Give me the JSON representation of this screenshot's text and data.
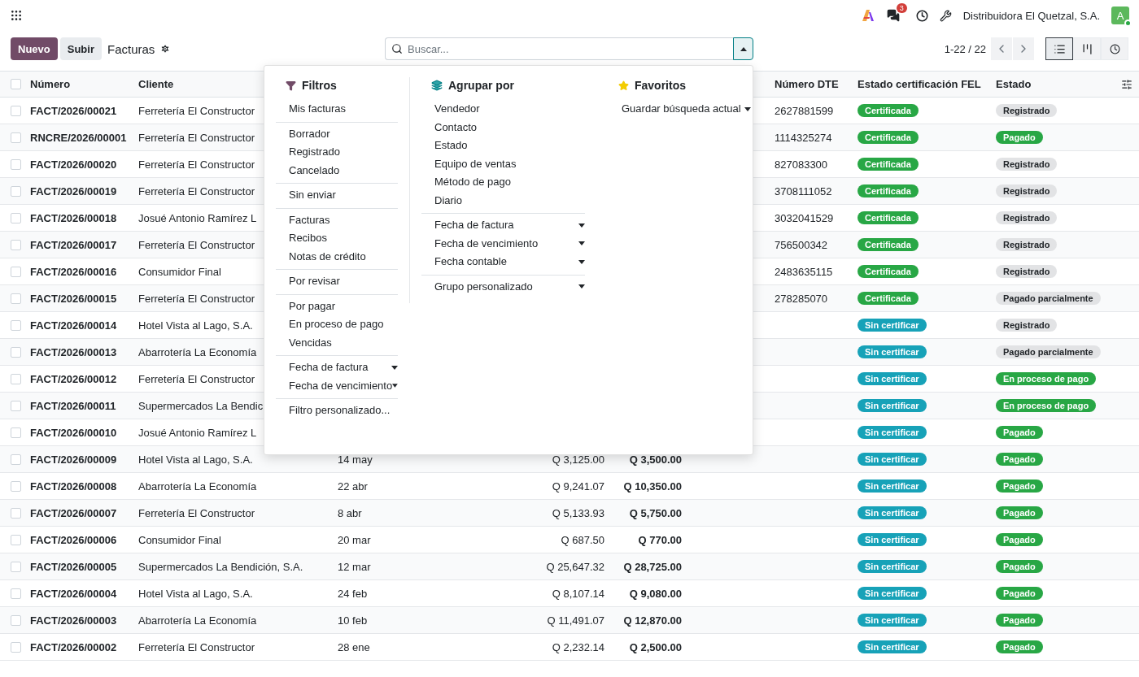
{
  "navbar": {
    "company": "Distribuidora El Quetzal, S.A.",
    "message_count": "3",
    "avatar": "A"
  },
  "control_panel": {
    "new_button": "Nuevo",
    "upload_button": "Subir",
    "title": "Facturas",
    "search": {
      "placeholder": "Buscar..."
    },
    "filter_toggle": {
      "expanded": true
    },
    "pager": "1-22 / 22",
    "views": [
      {
        "kind": "list",
        "selected": true
      },
      {
        "kind": "kanban",
        "selected": false
      },
      {
        "kind": "activity",
        "selected": false
      }
    ]
  },
  "table": {
    "select_all": false,
    "columns": [
      "Número",
      "Cliente",
      "Número DTE",
      "Estado certificación FEL",
      "Estado"
    ],
    "rows": [
      {
        "checked": false,
        "number": "FACT/2026/00021",
        "client": "Ferretería El Constructor",
        "dte": "2627881599",
        "fel": {
          "text": "Certificada",
          "color": "#28a745"
        },
        "status": {
          "text": "Registrado",
          "color": "#e2e3e5"
        }
      },
      {
        "checked": false,
        "number": "RNCRE/2026/00001",
        "client": "Ferretería El Constructor",
        "dte": "1114325274",
        "fel": {
          "text": "Certificada",
          "color": "#28a745"
        },
        "status": {
          "text": "Pagado",
          "color": "#28a745"
        }
      },
      {
        "checked": false,
        "number": "FACT/2026/00020",
        "client": "Ferretería El Constructor",
        "dte": "827083300",
        "fel": {
          "text": "Certificada",
          "color": "#28a745"
        },
        "status": {
          "text": "Registrado",
          "color": "#e2e3e5"
        }
      },
      {
        "checked": false,
        "number": "FACT/2026/00019",
        "client": "Ferretería El Constructor",
        "dte": "3708111052",
        "fel": {
          "text": "Certificada",
          "color": "#28a745"
        },
        "status": {
          "text": "Registrado",
          "color": "#e2e3e5"
        }
      },
      {
        "checked": false,
        "number": "FACT/2026/00018",
        "client": "Josué Antonio Ramírez L",
        "dte": "3032041529",
        "fel": {
          "text": "Certificada",
          "color": "#28a745"
        },
        "status": {
          "text": "Registrado",
          "color": "#e2e3e5"
        }
      },
      {
        "checked": false,
        "number": "FACT/2026/00017",
        "client": "Ferretería El Constructor",
        "dte": "756500342",
        "fel": {
          "text": "Certificada",
          "color": "#28a745"
        },
        "status": {
          "text": "Registrado",
          "color": "#e2e3e5"
        }
      },
      {
        "checked": false,
        "number": "FACT/2026/00016",
        "client": "Consumidor Final",
        "dte": "2483635115",
        "fel": {
          "text": "Certificada",
          "color": "#28a745"
        },
        "status": {
          "text": "Registrado",
          "color": "#e2e3e5"
        }
      },
      {
        "checked": false,
        "number": "FACT/2026/00015",
        "client": "Ferretería El Constructor",
        "dte": "278285070",
        "fel": {
          "text": "Certificada",
          "color": "#28a745"
        },
        "status": {
          "text": "Pagado parcialmente",
          "color": "#e2e3e5"
        }
      },
      {
        "checked": false,
        "number": "FACT/2026/00014",
        "client": "Hotel Vista al Lago, S.A.",
        "fel": {
          "text": "Sin certificar",
          "color": "#17a2b8"
        },
        "status": {
          "text": "Registrado",
          "color": "#e2e3e5"
        }
      },
      {
        "checked": false,
        "number": "FACT/2026/00013",
        "client": "Abarrotería La Economía",
        "fel": {
          "text": "Sin certificar",
          "color": "#17a2b8"
        },
        "status": {
          "text": "Pagado parcialmente",
          "color": "#e2e3e5"
        }
      },
      {
        "checked": false,
        "number": "FACT/2026/00012",
        "client": "Ferretería El Constructor",
        "fel": {
          "text": "Sin certificar",
          "color": "#17a2b8"
        },
        "status": {
          "text": "En proceso de pago",
          "color": "#28a745"
        }
      },
      {
        "checked": false,
        "number": "FACT/2026/00011",
        "client": "Supermercados La Bendic",
        "fel": {
          "text": "Sin certificar",
          "color": "#17a2b8"
        },
        "status": {
          "text": "En proceso de pago",
          "color": "#28a745"
        }
      },
      {
        "checked": false,
        "number": "FACT/2026/00010",
        "client": "Josué Antonio Ramírez L",
        "fel": {
          "text": "Sin certificar",
          "color": "#17a2b8"
        },
        "status": {
          "text": "Pagado",
          "color": "#28a745"
        }
      },
      {
        "checked": false,
        "number": "FACT/2026/00009",
        "client": "Hotel Vista al Lago, S.A.",
        "column_3": "14 may",
        "column_4": "Q 3,125.00",
        "column_5": "Q 3,500.00",
        "fel": {
          "text": "Sin certificar",
          "color": "#17a2b8"
        },
        "status": {
          "text": "Pagado",
          "color": "#28a745"
        }
      },
      {
        "checked": false,
        "number": "FACT/2026/00008",
        "client": "Abarrotería La Economía",
        "column_3": "22 abr",
        "column_4": "Q 9,241.07",
        "column_5": "Q 10,350.00",
        "fel": {
          "text": "Sin certificar",
          "color": "#17a2b8"
        },
        "status": {
          "text": "Pagado",
          "color": "#28a745"
        }
      },
      {
        "checked": false,
        "number": "FACT/2026/00007",
        "client": "Ferretería El Constructor",
        "column_3": "8 abr",
        "column_4": "Q 5,133.93",
        "column_5": "Q 5,750.00",
        "fel": {
          "text": "Sin certificar",
          "color": "#17a2b8"
        },
        "status": {
          "text": "Pagado",
          "color": "#28a745"
        }
      },
      {
        "checked": false,
        "number": "FACT/2026/00006",
        "client": "Consumidor Final",
        "column_3": "20 mar",
        "column_4": "Q 687.50",
        "column_5": "Q 770.00",
        "fel": {
          "text": "Sin certificar",
          "color": "#17a2b8"
        },
        "status": {
          "text": "Pagado",
          "color": "#28a745"
        }
      },
      {
        "checked": false,
        "number": "FACT/2026/00005",
        "client": "Supermercados La Bendición, S.A.",
        "column_3": "12 mar",
        "column_4": "Q 25,647.32",
        "column_5": "Q 28,725.00",
        "fel": {
          "text": "Sin certificar",
          "color": "#17a2b8"
        },
        "status": {
          "text": "Pagado",
          "color": "#28a745"
        }
      },
      {
        "checked": false,
        "number": "FACT/2026/00004",
        "client": "Hotel Vista al Lago, S.A.",
        "column_3": "24 feb",
        "column_4": "Q 8,107.14",
        "column_5": "Q 9,080.00",
        "fel": {
          "text": "Sin certificar",
          "color": "#17a2b8"
        },
        "status": {
          "text": "Pagado",
          "color": "#28a745"
        }
      },
      {
        "checked": false,
        "number": "FACT/2026/00003",
        "client": "Abarrotería La Economía",
        "column_3": "10 feb",
        "column_4": "Q 11,491.07",
        "column_5": "Q 12,870.00",
        "fel": {
          "text": "Sin certificar",
          "color": "#17a2b8"
        },
        "status": {
          "text": "Pagado",
          "color": "#28a745"
        }
      },
      {
        "checked": false,
        "number": "FACT/2026/00002",
        "client": "Ferretería El Constructor",
        "column_3": "28 ene",
        "column_4": "Q 2,232.14",
        "column_5": "Q 2,500.00",
        "fel": {
          "text": "Sin certificar",
          "color": "#17a2b8"
        },
        "status": {
          "text": "Pagado",
          "color": "#28a745"
        }
      }
    ]
  },
  "search_panel": [
    {
      "kind": "filters",
      "title": "Filtros",
      "groups": [
        [
          {
            "label": "Mis facturas",
            "caret": false
          }
        ],
        [
          {
            "label": "Borrador",
            "caret": false
          },
          {
            "label": "Registrado",
            "caret": false
          },
          {
            "label": "Cancelado",
            "caret": false
          }
        ],
        [
          {
            "label": "Sin enviar",
            "caret": false
          }
        ],
        [
          {
            "label": "Facturas",
            "caret": false
          },
          {
            "label": "Recibos",
            "caret": false
          },
          {
            "label": "Notas de crédito",
            "caret": false
          }
        ],
        [
          {
            "label": "Por revisar",
            "caret": false
          }
        ],
        [
          {
            "label": "Por pagar",
            "caret": false
          },
          {
            "label": "En proceso de pago",
            "caret": false
          },
          {
            "label": "Vencidas",
            "caret": false
          }
        ],
        [
          {
            "label": "Fecha de factura",
            "caret": true
          },
          {
            "label": "Fecha de vencimiento",
            "caret": true
          }
        ],
        [
          {
            "label": "Filtro personalizado...",
            "caret": false
          }
        ]
      ]
    },
    {
      "kind": "groupby",
      "title": "Agrupar por",
      "groups": [
        [
          {
            "label": "Vendedor",
            "caret": false
          },
          {
            "label": "Contacto",
            "caret": false
          },
          {
            "label": "Estado",
            "caret": false
          },
          {
            "label": "Equipo de ventas",
            "caret": false
          },
          {
            "label": "Método de pago",
            "caret": false
          },
          {
            "label": "Diario",
            "caret": false
          }
        ],
        [
          {
            "label": "Fecha de factura",
            "caret": true
          },
          {
            "label": "Fecha de vencimiento",
            "caret": true
          },
          {
            "label": "Fecha contable",
            "caret": true
          }
        ],
        [
          {
            "label": "Grupo personalizado",
            "caret": true
          }
        ]
      ]
    },
    {
      "kind": "favorites",
      "title": "Favoritos",
      "groups": [
        [
          {
            "label": "Guardar búsqueda actual",
            "caret": true
          }
        ]
      ]
    }
  ]
}
